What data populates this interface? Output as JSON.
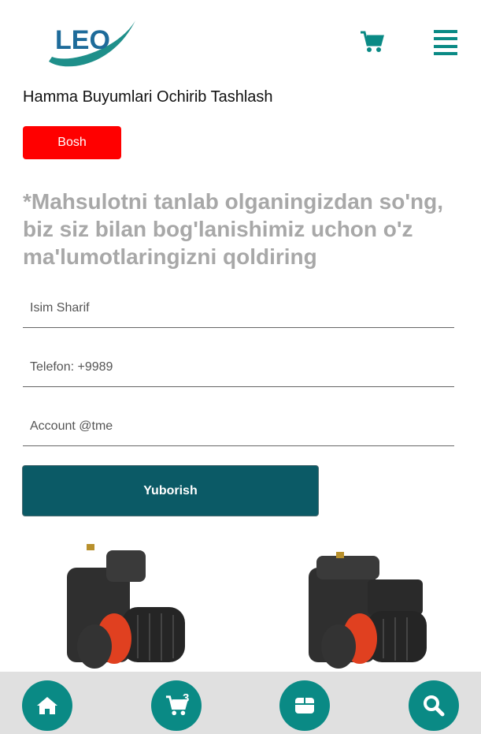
{
  "header": {
    "logo_text": "LEO",
    "cart_icon": "cart-icon",
    "menu_icon": "hamburger-menu-icon"
  },
  "cart": {
    "clear_all_label": "Hamma Buyumlari Ochirib Tashlash",
    "empty_label": "Bosh"
  },
  "form": {
    "notice": "*Mahsulotni tanlab olganingizdan so'ng, biz siz bilan bog'lanishimiz uchon o'z ma'lumotlaringizni qoldiring",
    "name_placeholder": "Isim Sharif",
    "phone_placeholder": "Telefon: +9989",
    "account_placeholder": "Account @tme",
    "submit_label": "Yuborish"
  },
  "products": [
    {
      "icon": "water-pump-image"
    },
    {
      "icon": "water-pump-image"
    }
  ],
  "bottom_nav": {
    "home_icon": "home-icon",
    "cart_icon": "cart-icon",
    "cart_count": "3",
    "box_icon": "box-icon",
    "search_icon": "search-icon"
  },
  "colors": {
    "brand_teal": "#0a8a85",
    "submit_bg": "#0b5a66",
    "danger": "#ff0000",
    "notice_text": "#a8a8a8",
    "bottom_bar": "#e0e0e0"
  }
}
